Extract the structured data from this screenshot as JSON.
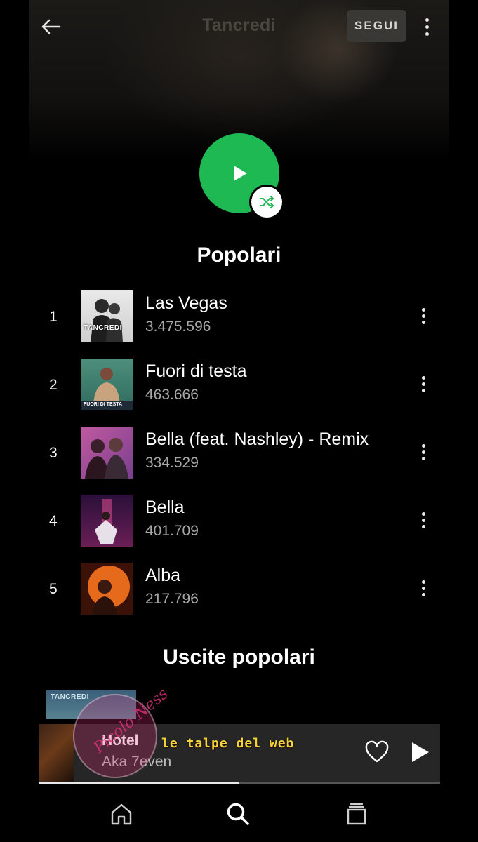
{
  "header": {
    "title": "Tancredi",
    "follow_label": "SEGUI",
    "back_icon": "arrow-left-icon",
    "more_icon": "more-vertical-icon"
  },
  "actions": {
    "play_icon": "play-icon",
    "shuffle_icon": "shuffle-icon",
    "accent_color": "#1fb954"
  },
  "popular": {
    "heading": "Popolari",
    "tracks": [
      {
        "rank": "1",
        "title": "Las Vegas",
        "plays": "3.475.596",
        "cover_text": "TANCREDI"
      },
      {
        "rank": "2",
        "title": "Fuori di testa",
        "plays": "463.666",
        "cover_text": "FUORI DI TESTA"
      },
      {
        "rank": "3",
        "title": "Bella (feat. Nashley) - Remix",
        "plays": "334.529"
      },
      {
        "rank": "4",
        "title": "Bella",
        "plays": "401.709"
      },
      {
        "rank": "5",
        "title": "Alba",
        "plays": "217.796"
      }
    ]
  },
  "releases": {
    "heading": "Uscite popolari",
    "peek_label": "TANCREDI"
  },
  "now_playing": {
    "title": "Hotel",
    "artist": "Aka 7even",
    "progress": 0.5
  },
  "watermark": {
    "text": "le talpe del web",
    "script": "Picolo Ness"
  },
  "nav": {
    "items": [
      {
        "icon": "home-icon"
      },
      {
        "icon": "search-icon"
      },
      {
        "icon": "library-icon"
      }
    ]
  }
}
